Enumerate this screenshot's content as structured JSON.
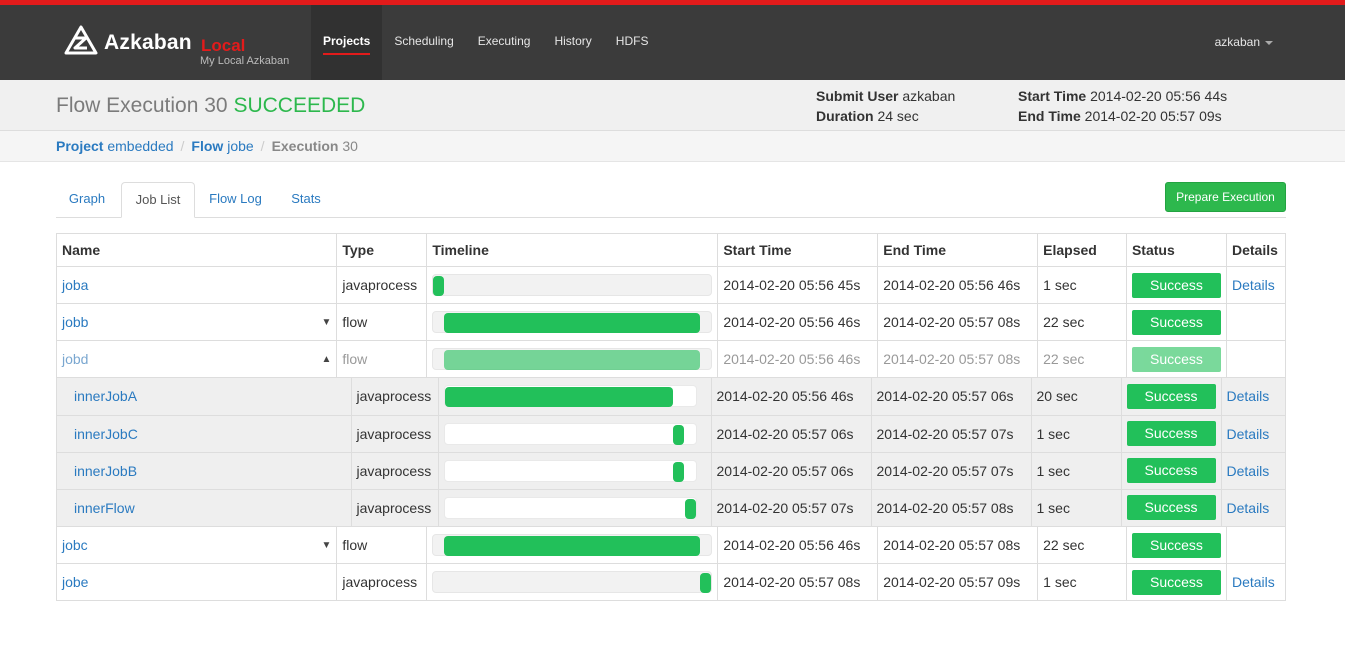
{
  "app": {
    "name": "Azkaban",
    "env": "Local",
    "subtitle": "My Local Azkaban"
  },
  "nav": {
    "items": [
      {
        "label": "Projects",
        "active": true
      },
      {
        "label": "Scheduling",
        "active": false
      },
      {
        "label": "Executing",
        "active": false
      },
      {
        "label": "History",
        "active": false
      },
      {
        "label": "HDFS",
        "active": false
      }
    ],
    "user": "azkaban"
  },
  "header": {
    "title_prefix": "Flow Execution 30",
    "title_status": "SUCCEEDED",
    "submit_user_label": "Submit User",
    "submit_user": "azkaban",
    "duration_label": "Duration",
    "duration": "24 sec",
    "start_time_label": "Start Time",
    "start_time": "2014-02-20 05:56 44s",
    "end_time_label": "End Time",
    "end_time": "2014-02-20 05:57 09s"
  },
  "breadcrumb": {
    "project_label": "Project",
    "project": "embedded",
    "flow_label": "Flow",
    "flow": "jobe",
    "execution_label": "Execution",
    "execution": "30"
  },
  "tabs": [
    {
      "label": "Graph",
      "active": false
    },
    {
      "label": "Job List",
      "active": true
    },
    {
      "label": "Flow Log",
      "active": false
    },
    {
      "label": "Stats",
      "active": false
    }
  ],
  "prepare_button": "Prepare Execution",
  "table": {
    "columns": [
      "Name",
      "Type",
      "Timeline",
      "Start Time",
      "End Time",
      "Elapsed",
      "Status",
      "Details"
    ],
    "rows": [
      {
        "name": "joba",
        "type": "javaprocess",
        "start": "2014-02-20 05:56 45s",
        "end": "2014-02-20 05:56 46s",
        "elapsed": "1 sec",
        "status": "Success",
        "details": "Details",
        "timeline": [
          0.0,
          0.04
        ]
      },
      {
        "name": "jobb",
        "type": "flow",
        "start": "2014-02-20 05:56 46s",
        "end": "2014-02-20 05:57 08s",
        "elapsed": "22 sec",
        "status": "Success",
        "details": "",
        "timeline": [
          0.04,
          0.96
        ]
      },
      {
        "name": "jobd",
        "type": "flow",
        "start": "2014-02-20 05:56 46s",
        "end": "2014-02-20 05:57 08s",
        "elapsed": "22 sec",
        "status": "Success",
        "details": "",
        "timeline": [
          0.04,
          0.96
        ]
      },
      {
        "name": "jobc",
        "type": "flow",
        "start": "2014-02-20 05:56 46s",
        "end": "2014-02-20 05:57 08s",
        "elapsed": "22 sec",
        "status": "Success",
        "details": "",
        "timeline": [
          0.04,
          0.96
        ]
      },
      {
        "name": "jobe",
        "type": "javaprocess",
        "start": "2014-02-20 05:57 08s",
        "end": "2014-02-20 05:57 09s",
        "elapsed": "1 sec",
        "status": "Success",
        "details": "Details",
        "timeline": [
          0.96,
          1.0
        ]
      }
    ],
    "nested": [
      {
        "name": "innerJobA",
        "type": "javaprocess",
        "start": "2014-02-20 05:56 46s",
        "end": "2014-02-20 05:57 06s",
        "elapsed": "20 sec",
        "status": "Success",
        "details": "Details",
        "timeline": [
          0.0,
          0.91
        ]
      },
      {
        "name": "innerJobC",
        "type": "javaprocess",
        "start": "2014-02-20 05:57 06s",
        "end": "2014-02-20 05:57 07s",
        "elapsed": "1 sec",
        "status": "Success",
        "details": "Details",
        "timeline": [
          0.91,
          0.955
        ]
      },
      {
        "name": "innerJobB",
        "type": "javaprocess",
        "start": "2014-02-20 05:57 06s",
        "end": "2014-02-20 05:57 07s",
        "elapsed": "1 sec",
        "status": "Success",
        "details": "Details",
        "timeline": [
          0.91,
          0.955
        ]
      },
      {
        "name": "innerFlow",
        "type": "javaprocess",
        "start": "2014-02-20 05:57 07s",
        "end": "2014-02-20 05:57 08s",
        "elapsed": "1 sec",
        "status": "Success",
        "details": "Details",
        "timeline": [
          0.955,
          1.0
        ]
      }
    ]
  }
}
